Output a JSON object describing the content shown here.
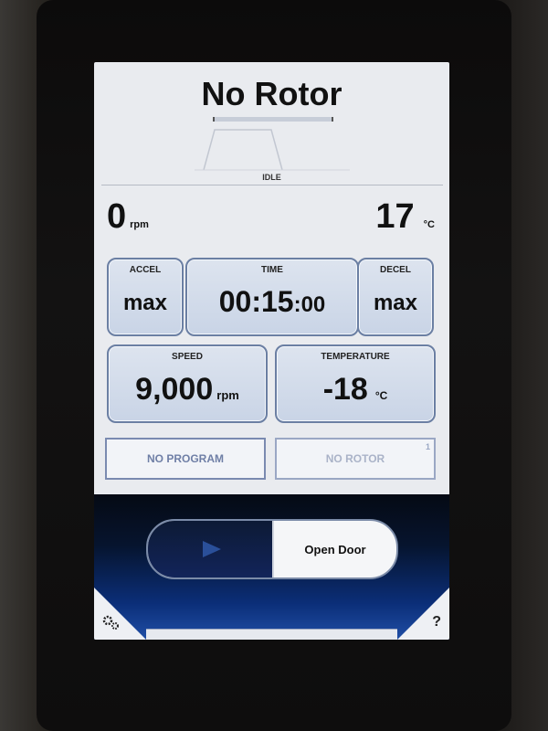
{
  "header": {
    "title": "No Rotor",
    "state": "IDLE"
  },
  "current": {
    "speed_value": "0",
    "speed_unit": "rpm",
    "temp_value": "17",
    "temp_unit": "°C"
  },
  "controls": {
    "accel": {
      "label": "ACCEL",
      "value": "max"
    },
    "time": {
      "label": "TIME",
      "value_main": "00:15",
      "value_sec": ":00"
    },
    "decel": {
      "label": "DECEL",
      "value": "max"
    },
    "speed": {
      "label": "SPEED",
      "value": "9,000",
      "unit": "rpm"
    },
    "temperature": {
      "label": "TEMPERATURE",
      "value": "-18",
      "unit": "°C"
    }
  },
  "program": {
    "label": "NO PROGRAM"
  },
  "rotor": {
    "label": "NO ROTOR",
    "index": "1"
  },
  "actions": {
    "open_door": "Open Door"
  },
  "footer": {
    "help": "?"
  },
  "colors": {
    "tile_border": "#6b7fa3",
    "accent_blue": "#0b2e78",
    "muted_text": "#7f8fb0"
  }
}
